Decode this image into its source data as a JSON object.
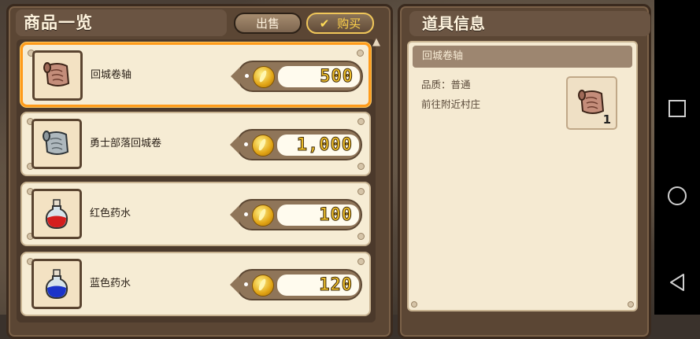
{
  "shop": {
    "title": "商品一览",
    "tabs": {
      "sell": "出售",
      "buy": "购买"
    },
    "items": [
      {
        "name": "回城卷轴",
        "price": "500",
        "icon": "scroll-icon",
        "selected": true
      },
      {
        "name": "勇士部落回城卷",
        "price": "1,000",
        "icon": "silver-scroll-icon",
        "selected": false
      },
      {
        "name": "红色药水",
        "price": "100",
        "icon": "red-potion-icon",
        "selected": false
      },
      {
        "name": "蓝色药水",
        "price": "120",
        "icon": "blue-potion-icon",
        "selected": false
      }
    ]
  },
  "info": {
    "title": "道具信息",
    "item_name": "回城卷轴",
    "quality_line": "品质：普通",
    "description": "前往附近村庄",
    "quantity": "1",
    "icon": "scroll-icon"
  },
  "colors": {
    "selected_border": "#ff9b1a",
    "price_text": "#f1c12a",
    "buy_tab_text": "#ffd24a"
  }
}
